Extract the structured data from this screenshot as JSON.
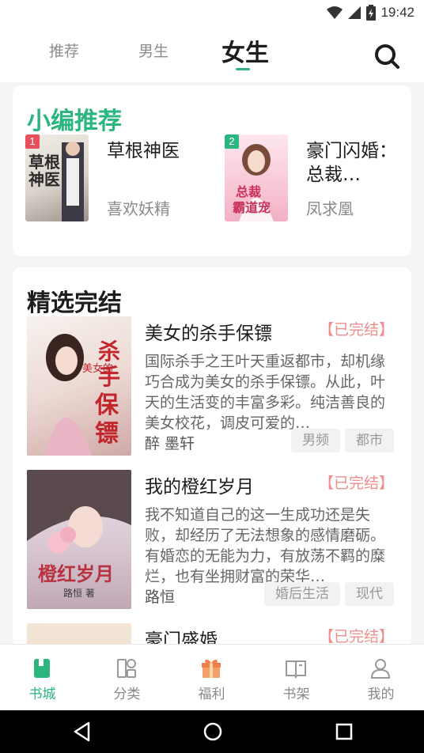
{
  "status_bar": {
    "time": "19:42",
    "icons": [
      "wifi-icon",
      "signal-icon",
      "battery-icon"
    ]
  },
  "tabs": [
    {
      "label": "推荐"
    },
    {
      "label": "男生"
    },
    {
      "label": "女生",
      "active": true
    }
  ],
  "featured": {
    "title": "小编推荐",
    "items": [
      {
        "rank": "1",
        "title": "草根神医",
        "author": "喜欢妖精",
        "rank_color": "#e8505b",
        "cover_text": "草根神医"
      },
      {
        "rank": "2",
        "title": "豪门闪婚：总裁…",
        "author": "凤求凰",
        "rank_color": "#2bb57f",
        "cover_text": "总裁霸道宠"
      }
    ]
  },
  "selected": {
    "title": "精选完结",
    "books": [
      {
        "title": "美女的杀手保镖",
        "status": "【已完结】",
        "description": "国际杀手之王叶天重返都市，却机缘巧合成为美女的杀手保镖。从此，叶天的生活变的丰富多彩。纯洁善良的美女校花，调皮可爱的…",
        "author": "醉 墨轩",
        "tags": [
          "男频",
          "都市"
        ],
        "cover_text": "美女的杀手保镖"
      },
      {
        "title": "我的橙红岁月",
        "status": "【已完结】",
        "description": "我不知道自己的这一生成功还是失败，却经历了无法想象的感情磨砺。有婚恋的无能为力，有放荡不羁的糜烂，也有坐拥财富的荣华…",
        "author": "路恒",
        "tags": [
          "婚后生活",
          "现代"
        ],
        "cover_text": "我的橙红岁月"
      },
      {
        "title": "豪门盛婚",
        "status": "【已完结】",
        "description": "",
        "author": "",
        "tags": [],
        "cover_text": ""
      }
    ]
  },
  "bottom_nav": [
    {
      "label": "书城",
      "icon": "bookstore-icon",
      "active": true
    },
    {
      "label": "分类",
      "icon": "category-icon"
    },
    {
      "label": "福利",
      "icon": "gift-icon"
    },
    {
      "label": "书架",
      "icon": "bookshelf-icon"
    },
    {
      "label": "我的",
      "icon": "profile-icon"
    }
  ],
  "colors": {
    "accent": "#2bb57f",
    "status_done": "#f08d8d"
  }
}
